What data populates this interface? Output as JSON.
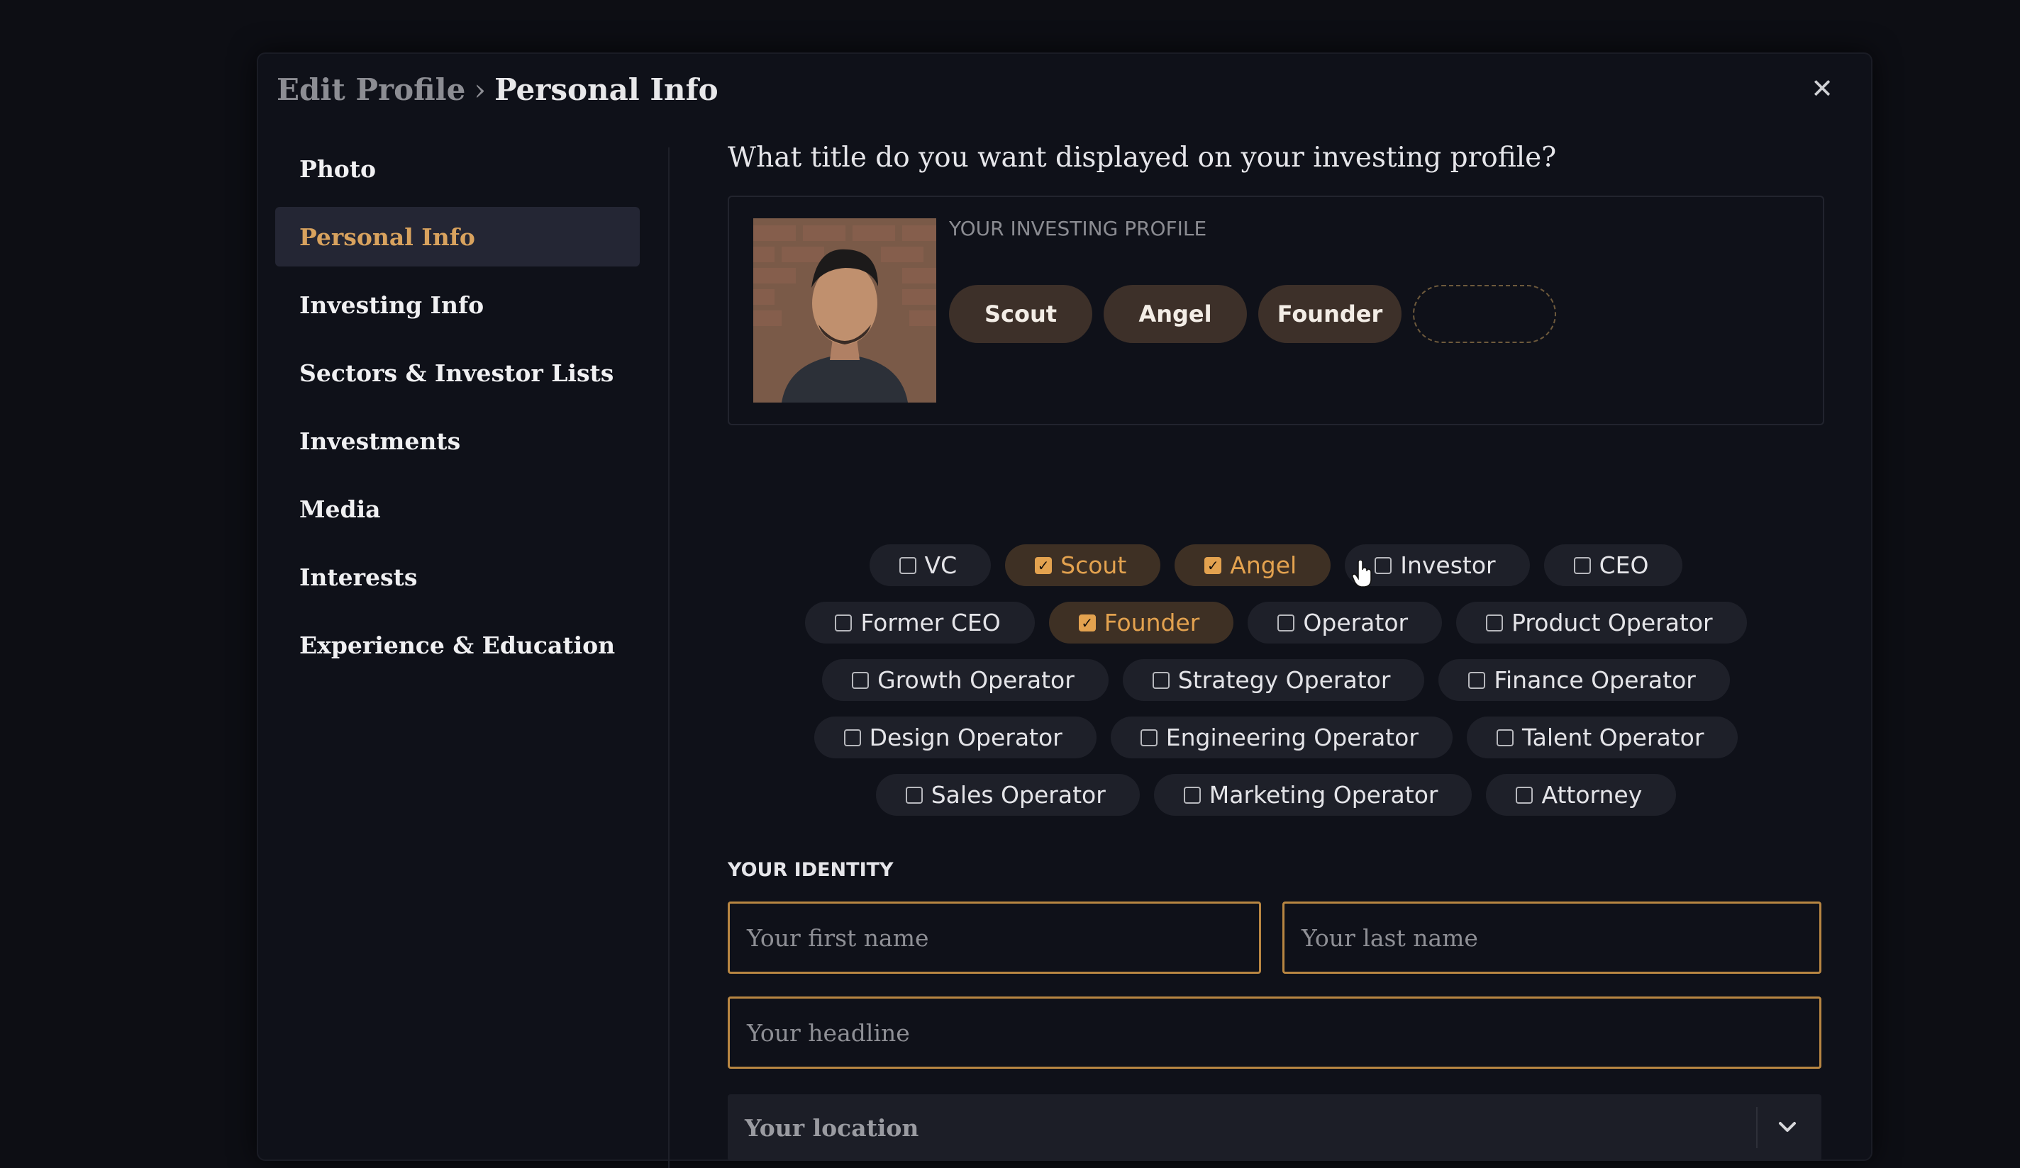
{
  "breadcrumb": {
    "parent": "Edit Profile",
    "separator": "›",
    "current": "Personal Info"
  },
  "close_label": "✕",
  "sidebar": {
    "items": [
      {
        "label": "Photo",
        "active": false
      },
      {
        "label": "Personal Info",
        "active": true
      },
      {
        "label": "Investing Info",
        "active": false
      },
      {
        "label": "Sectors & Investor Lists",
        "active": false
      },
      {
        "label": "Investments",
        "active": false
      },
      {
        "label": "Media",
        "active": false
      },
      {
        "label": "Interests",
        "active": false
      },
      {
        "label": "Experience & Education",
        "active": false
      }
    ]
  },
  "main": {
    "question": "What title do you want displayed on your investing profile?",
    "profile_label": "YOUR INVESTING PROFILE",
    "profile_pills": [
      "Scout",
      "Angel",
      "Founder"
    ],
    "chip_rows": [
      [
        {
          "label": "VC",
          "checked": false
        },
        {
          "label": "Scout",
          "checked": true
        },
        {
          "label": "Angel",
          "checked": true
        },
        {
          "label": "Investor",
          "checked": false
        },
        {
          "label": "CEO",
          "checked": false
        }
      ],
      [
        {
          "label": "Former CEO",
          "checked": false
        },
        {
          "label": "Founder",
          "checked": true
        },
        {
          "label": "Operator",
          "checked": false
        },
        {
          "label": "Product Operator",
          "checked": false
        }
      ],
      [
        {
          "label": "Growth Operator",
          "checked": false
        },
        {
          "label": "Strategy Operator",
          "checked": false
        },
        {
          "label": "Finance Operator",
          "checked": false
        }
      ],
      [
        {
          "label": "Design Operator",
          "checked": false
        },
        {
          "label": "Engineering Operator",
          "checked": false
        },
        {
          "label": "Talent Operator",
          "checked": false
        }
      ],
      [
        {
          "label": "Sales Operator",
          "checked": false
        },
        {
          "label": "Marketing Operator",
          "checked": false
        },
        {
          "label": "Attorney",
          "checked": false
        }
      ]
    ],
    "check_glyph": "✓",
    "identity_label": "YOUR IDENTITY",
    "first_name_placeholder": "Your first name",
    "last_name_placeholder": "Your last name",
    "headline_placeholder": "Your headline",
    "location_placeholder": "Your location"
  },
  "colors": {
    "accent": "#e3a24f",
    "field_border": "#b88642",
    "background": "#0f1119"
  }
}
